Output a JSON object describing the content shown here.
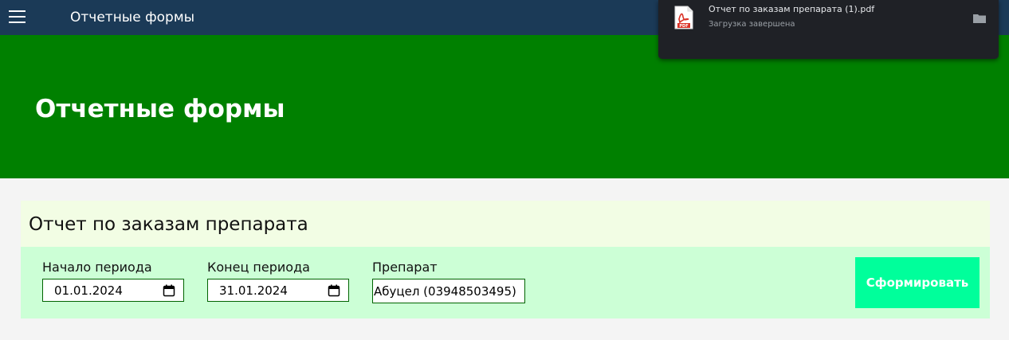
{
  "app": {
    "title": "Отчетные формы"
  },
  "hero": {
    "title": "Отчетные формы"
  },
  "report": {
    "title": "Отчет по заказам препарата",
    "start": {
      "label": "Начало периода",
      "value": "01.01.2024"
    },
    "end": {
      "label": "Конец периода",
      "value": "31.01.2024"
    },
    "drug": {
      "label": "Препарат",
      "value": "Абуцел (03948503495)"
    },
    "submit_label": "Сформировать"
  },
  "download": {
    "filename": "Отчет по заказам препарата (1).pdf",
    "status": "Загрузка завершена"
  },
  "colors": {
    "topbar": "#1b3a57",
    "hero": "#008000",
    "card_header": "#f2fde4",
    "card_body": "#ccffd6",
    "button": "#00ff9b"
  },
  "icons": {
    "menu": "hamburger-icon",
    "calendar": "calendar-icon",
    "file": "pdf-file-icon",
    "folder": "folder-icon"
  }
}
